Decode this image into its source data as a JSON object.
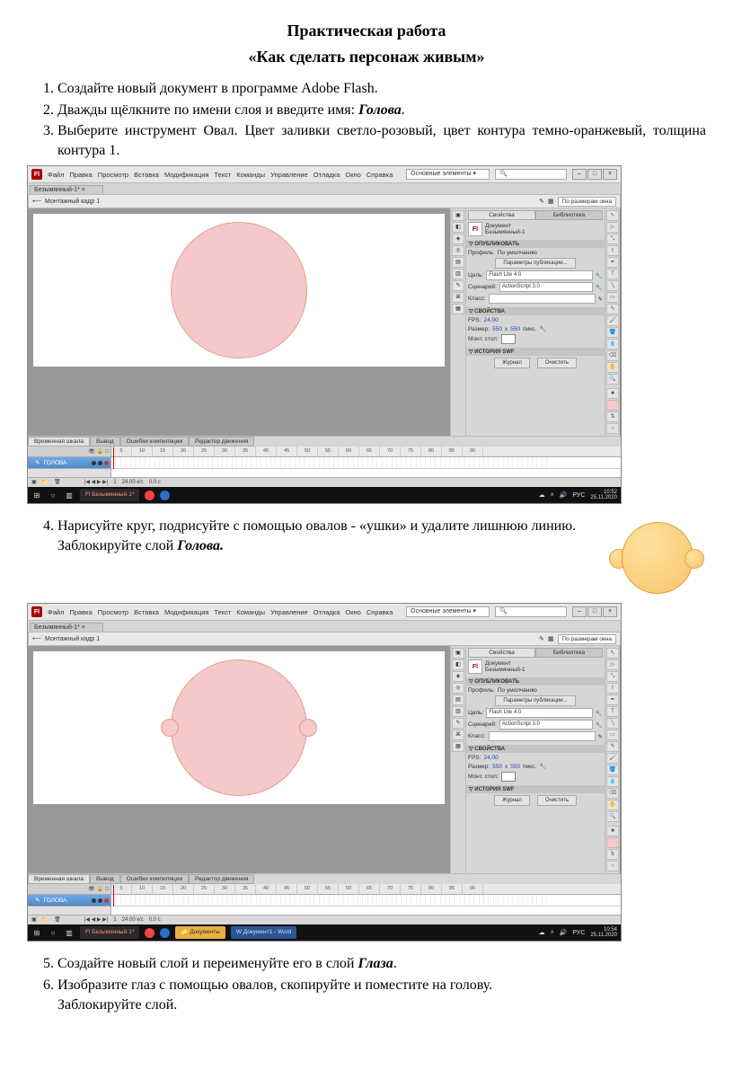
{
  "title": "Практическая работа",
  "subtitle": "«Как сделать персонаж живым»",
  "steps": {
    "s1": "Создайте новый документ в программе Adobe Flash.",
    "s2_a": "Дважды щёлкните по имени слоя и введите имя: ",
    "s2_b": "Голова",
    "s2_c": ".",
    "s3": "Выберите инструмент Овал. Цвет заливки светло-розовый, цвет контура темно-оранжевый, толщина контура 1.",
    "s4_a": "Нарисуйте круг, подрисуйте с помощью овалов - «ушки» и удалите лишнюю линию.",
    "s4_b": "Заблокируйте слой ",
    "s4_c": "Голова.",
    "s5_a": "Создайте новый слой и переименуйте его в слой ",
    "s5_b": "Глаза",
    "s5_c": ".",
    "s6_a": "Изобразите глаз с помощью овалов, скопируйте и поместите на голову.",
    "s6_b": "Заблокируйте слой."
  },
  "ide": {
    "menus": [
      "Файл",
      "Правка",
      "Просмотр",
      "Вставка",
      "Модификация",
      "Текст",
      "Команды",
      "Управление",
      "Отладка",
      "Окно",
      "Справка"
    ],
    "workspace_combo": "Основные элементы ▾",
    "search_placeholder": "",
    "doc_tab": "Безымянный-1* ×",
    "scene": "Монтажный кадр 1",
    "zoom_mode": "По размерам окна",
    "panel_tabs": {
      "props": "Свойства",
      "lib": "Библиотека"
    },
    "doc_label": "Документ",
    "doc_name": "Безымянный-1",
    "sec_publish": "ОПУБЛИКОВАТЬ",
    "profile_lbl": "Профиль:",
    "profile_val": "По умолчанию",
    "pub_settings_btn": "Параметры публикации...",
    "target_lbl": "Цель:",
    "target_val": "Flash Lite 4.0",
    "script_lbl": "Сценарий:",
    "script_val": "ActionScript 3.0",
    "class_lbl": "Класс:",
    "sec_props": "СВОЙСТВА",
    "fps_lbl": "FPS:",
    "fps_val": "24,00",
    "size_lbl": "Размер:",
    "size_w": "550",
    "size_x": "x",
    "size_h": "550",
    "size_unit": "пикс.",
    "stage_lbl": "Монт. стол:",
    "sec_swf": "ИСТОРИЯ SWF",
    "swf_btn1": "Журнал",
    "swf_btn2": "Очистить",
    "timeline_tabs": {
      "tl": "Временная шкала",
      "out": "Вывод",
      "err": "Ошибки компиляции",
      "me": "Редактор движения"
    },
    "layer_name": "ГОЛОВА",
    "ruler": [
      "5",
      "10",
      "15",
      "20",
      "25",
      "30",
      "35",
      "40",
      "45",
      "50",
      "55",
      "60",
      "65",
      "70",
      "75",
      "80",
      "85",
      "90"
    ],
    "tl_foot_frame": "1",
    "tl_foot_fps": "24.00 к/с",
    "tl_foot_time": "0.0 с"
  },
  "taskbar1": {
    "app1": "Безымянный-1*",
    "lang": "РУС",
    "time": "10:52",
    "date": "25.11.2020"
  },
  "taskbar2": {
    "app1": "Безымянный-1*",
    "app2": "Документы",
    "app3": "Документ1 - Word",
    "lang": "РУС",
    "time": "10:54",
    "date": "25.11.2020"
  }
}
